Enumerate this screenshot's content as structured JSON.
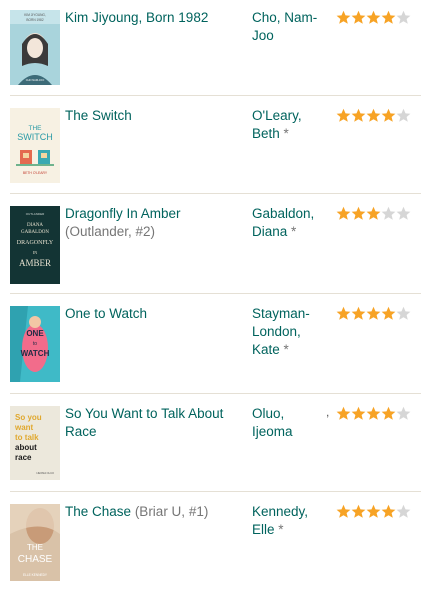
{
  "books": [
    {
      "title": "Kim Jiyoung, Born 1982",
      "series": "",
      "author_last": "Cho, Nam-",
      "author_first": "Joo",
      "author_mark": "",
      "rating": 4,
      "max_rating": 5,
      "cover_icon": "kim-jiyoung-cover",
      "cover_title": "KIM JIYOUNG, BORN 1982",
      "cover_author": "CHO NAM-JOO"
    },
    {
      "title": "The Switch",
      "series": "",
      "author_last": "O'Leary,",
      "author_first": "Beth",
      "author_mark": "*",
      "rating": 4,
      "max_rating": 5,
      "cover_icon": "the-switch-cover",
      "cover_title": "THE SWITCH",
      "cover_author": "BETH O'LEARY"
    },
    {
      "title": "Dragonfly In Amber",
      "series": "(Outlander, #2)",
      "author_last": "Gabaldon,",
      "author_first": "Diana",
      "author_mark": "*",
      "rating": 3,
      "max_rating": 5,
      "cover_icon": "dragonfly-in-amber-cover",
      "cover_title": "DRAGONFLY IN AMBER",
      "cover_author": "DIANA GABALDON"
    },
    {
      "title": "One to Watch",
      "series": "",
      "author_last": "Stayman-",
      "author_mid": "London,",
      "author_first": "Kate",
      "author_mark": "*",
      "rating": 4,
      "max_rating": 5,
      "cover_icon": "one-to-watch-cover",
      "cover_title": "ONE TO WATCH"
    },
    {
      "title": "So You Want to Talk About Race",
      "series": "",
      "author_last": "Oluo,",
      "author_first": "Ijeoma",
      "author_mark": "",
      "rating": 4,
      "max_rating": 5,
      "trunc_mark": ",",
      "cover_icon": "so-you-want-to-talk-about-race-cover",
      "cover_lines": [
        "So you",
        "want",
        "to talk",
        "about",
        "race"
      ]
    },
    {
      "title": "The Chase",
      "series": "(Briar U, #1)",
      "author_last": "Kennedy,",
      "author_first": "Elle",
      "author_mark": "*",
      "rating": 4,
      "max_rating": 5,
      "cover_icon": "the-chase-cover",
      "cover_title": "THE CHASE",
      "cover_author": "ELLE KENNEDY"
    }
  ],
  "colors": {
    "link": "#00635d",
    "muted": "#767676",
    "star_on": "#f7a325",
    "star_off": "#d6d6d6",
    "divider": "#e5e0d5"
  },
  "icons": {
    "star": "star-icon"
  }
}
